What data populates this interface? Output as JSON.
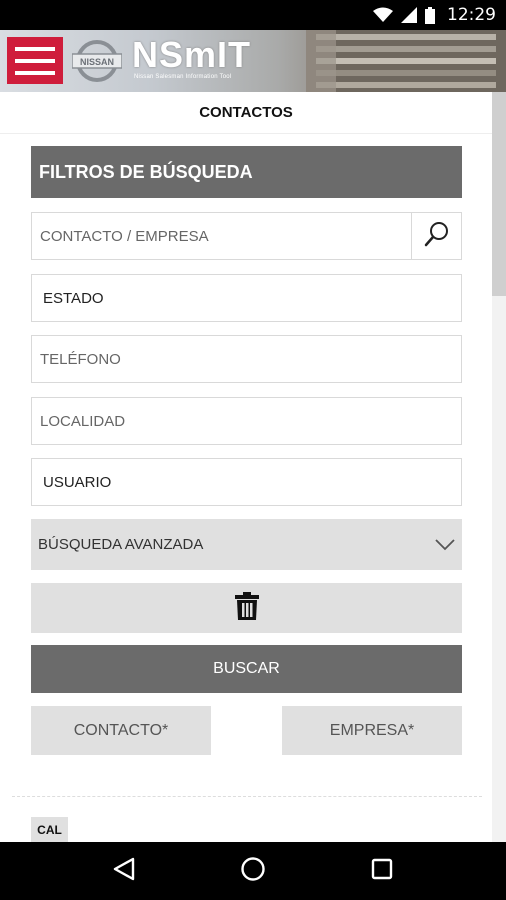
{
  "status_bar": {
    "time": "12:29",
    "icons": [
      "wifi-icon",
      "signal-icon",
      "battery-icon"
    ]
  },
  "header": {
    "menu_icon": "hamburger-menu-icon",
    "logo_text": "NISSAN",
    "brand_title": "NSmIT",
    "brand_subtitle": "Nissan Salesman Information Tool",
    "accent_color": "#cf1d3b"
  },
  "page": {
    "title": "CONTACTOS"
  },
  "filters": {
    "header": "FILTROS DE BÚSQUEDA",
    "contact_company": {
      "placeholder": "CONTACTO / EMPRESA",
      "icon": "search-icon"
    },
    "estado": {
      "value": "ESTADO"
    },
    "telefono": {
      "placeholder": "TELÉFONO"
    },
    "localidad": {
      "placeholder": "LOCALIDAD"
    },
    "usuario": {
      "value": "USUARIO"
    },
    "advanced": {
      "label": "BÚSQUEDA AVANZADA",
      "icon": "chevron-down-icon"
    },
    "clear_icon": "trash-icon",
    "search_button": "BUSCAR",
    "contact_button": "CONTACTO*",
    "company_button": "EMPRESA*"
  },
  "results": {
    "tag": "CAL"
  },
  "nav_bar": {
    "icons": [
      "back-icon",
      "home-icon",
      "recents-icon"
    ]
  },
  "colors": {
    "dark_gray": "#6b6b6b",
    "light_gray": "#e0e0e0",
    "border": "#d9d9d9"
  }
}
